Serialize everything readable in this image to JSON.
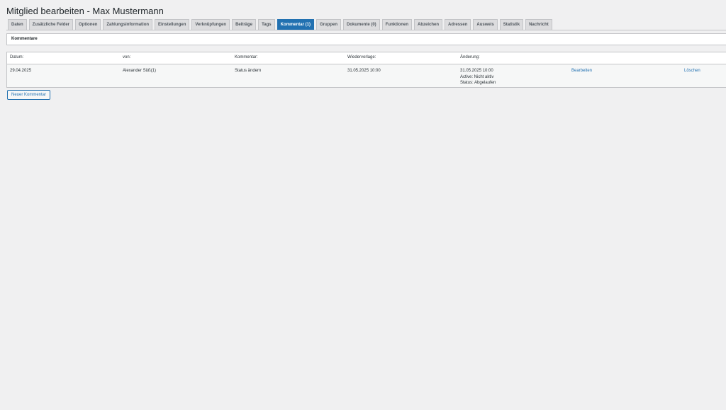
{
  "page": {
    "title": "Mitglied bearbeiten - Max Mustermann"
  },
  "tabs": [
    {
      "label": "Daten"
    },
    {
      "label": "Zusätzliche Felder"
    },
    {
      "label": "Optionen"
    },
    {
      "label": "Zahlungsinformation"
    },
    {
      "label": "Einstellungen"
    },
    {
      "label": "Verknüpfungen"
    },
    {
      "label": "Beiträge"
    },
    {
      "label": "Tags"
    },
    {
      "label": "Kommentar (1)",
      "active": true
    },
    {
      "label": "Gruppen"
    },
    {
      "label": "Dokumente (0)"
    },
    {
      "label": "Funktionen"
    },
    {
      "label": "Abzeichen"
    },
    {
      "label": "Adressen"
    },
    {
      "label": "Ausweis"
    },
    {
      "label": "Statistik"
    },
    {
      "label": "Nachricht"
    }
  ],
  "panel": {
    "title": "Kommentare"
  },
  "table": {
    "headers": [
      "Datum:",
      "von:",
      "Kommentar:",
      "Wiedervorlage:",
      "Änderung:"
    ],
    "rows": [
      {
        "datum": "29.04.2025",
        "von": "Alexander Süß(1)",
        "kommentar": "Status ändern",
        "wiedervorlage": "31.05.2025 10:00",
        "aenderung": [
          "31.05.2025 10:00",
          "Active: Nicht aktiv",
          "Status: Abgelaufen"
        ],
        "edit_label": "Bearbeiten",
        "delete_label": "Löschen"
      }
    ]
  },
  "actions": {
    "new_comment_label": "Neuer Kommentar"
  },
  "colors": {
    "accent": "#2271b1",
    "background": "#f0f0f1",
    "tab_inactive": "#dcdcde"
  }
}
